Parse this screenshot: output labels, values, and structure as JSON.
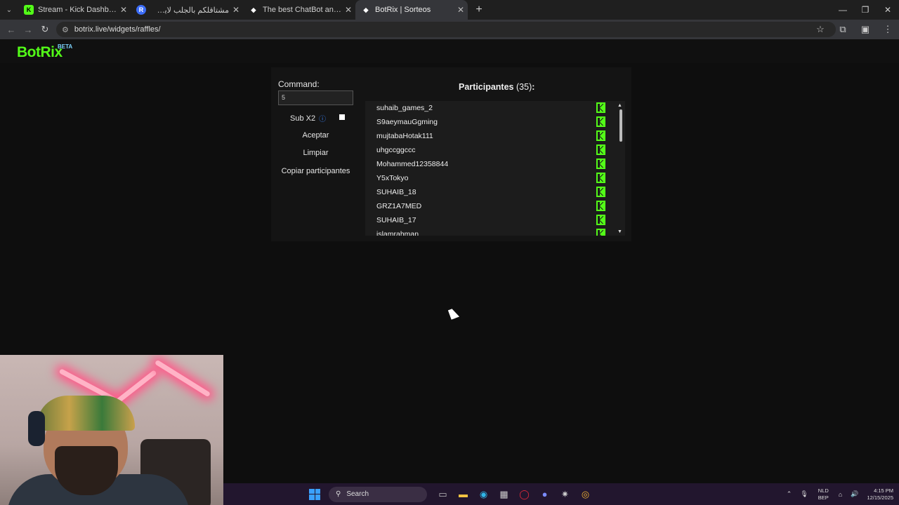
{
  "browser": {
    "tabs": [
      {
        "title": "Stream - Kick Dashboard",
        "icon": "kick-icon",
        "active": false
      },
      {
        "title": "مشتاقلكم بالجلب لايف توزيع + ...",
        "icon": "r-icon",
        "active": false
      },
      {
        "title": "The best ChatBot and Widgets",
        "icon": "botrix-icon",
        "active": false
      },
      {
        "title": "BotRix | Sorteos",
        "icon": "botrix-icon",
        "active": true
      }
    ],
    "url": "botrix.live/widgets/raffles/"
  },
  "app": {
    "logo": "BotRix",
    "badge": "BETA"
  },
  "raffle": {
    "command_label": "Command:",
    "command_value": "5",
    "sub_label": "Sub X2",
    "sub_checked": false,
    "accept_label": "Aceptar",
    "clear_label": "Limpiar",
    "copy_label": "Copiar participantes",
    "participants_title": "Participantes",
    "participants_count": "(35)",
    "participants_suffix": ":",
    "participants": [
      "suhaib_games_2",
      "S9aeymauGgming",
      "mujtabaHotak111",
      "uhgccggccc",
      "Mohammed12358844",
      "Y5xTokyo",
      "SUHAIB_18",
      "GRZ1A7MED",
      "SUHAIB_17",
      "islamrahman"
    ]
  },
  "taskbar": {
    "search_placeholder": "Search",
    "lang_top": "NLD",
    "lang_bottom": "BEP",
    "time": "4:15 PM",
    "date": "12/15/2025"
  }
}
